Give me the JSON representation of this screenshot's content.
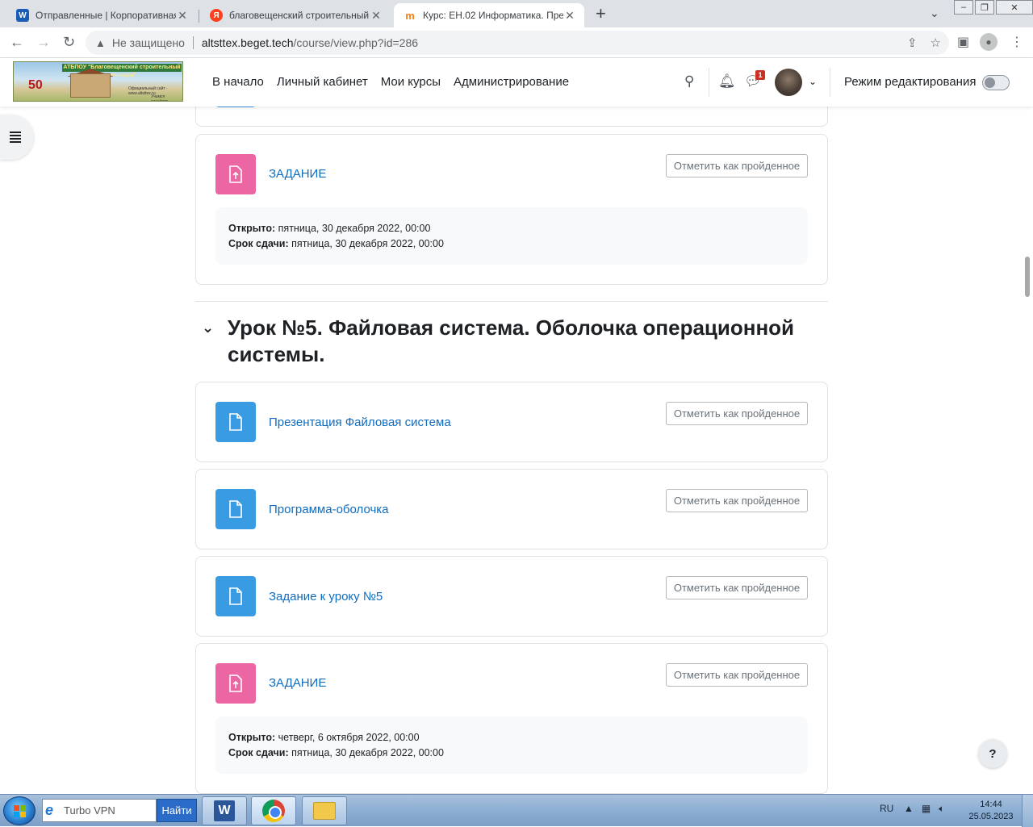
{
  "browser": {
    "tabs": [
      {
        "title": "Отправленные | Корпоративная",
        "favicon_color": "#1a5bb5"
      },
      {
        "title": "благовещенский строительный",
        "favicon_color": "#fc3f1d"
      },
      {
        "title": "Курс: ЕН.02 Информатика. Пре",
        "favicon_color": "#f98012"
      }
    ],
    "new_tab": "+",
    "insecure_label": "Не защищено",
    "url_host": "altsttex.beget.tech",
    "url_path": "/course/view.php?id=286"
  },
  "navbar": {
    "logo": {
      "banner": "АТБПОУ \"Благовещенский строительный техникум\"",
      "fifty": "50",
      "site": "Официальный сайт · www.altsttex.ru",
      "motto": "Учимся созидать"
    },
    "menu": [
      "В начало",
      "Личный кабинет",
      "Мои курсы",
      "Администрирование"
    ],
    "messages_badge": "1",
    "edit_mode_label": "Режим редактирования"
  },
  "content": {
    "mark_label": "Отметить как пройденное",
    "assignment1": {
      "name": "ЗАДАНИЕ",
      "opened_label": "Открыто:",
      "opened_value": "пятница, 30 декабря 2022, 00:00",
      "due_label": "Срок сдачи:",
      "due_value": "пятница, 30 декабря 2022, 00:00"
    },
    "section_title": "Урок №5. Файловая система. Оболочка операционной системы.",
    "activities": [
      {
        "name": "Презентация Файловая система"
      },
      {
        "name": "Программа-оболочка"
      },
      {
        "name": "Задание к уроку №5"
      }
    ],
    "assignment2": {
      "name": "ЗАДАНИЕ",
      "opened_label": "Открыто:",
      "opened_value": "четверг, 6 октября 2022, 00:00",
      "due_label": "Срок сдачи:",
      "due_value": "пятница, 30 декабря 2022, 00:00"
    },
    "help": "?"
  },
  "taskbar": {
    "search_placeholder": "Turbo VPN",
    "find_label": "Найти",
    "word_letter": "W",
    "lang": "RU",
    "time": "14:44",
    "date": "25.05.2023"
  },
  "colors": {
    "link": "#0f6cbf",
    "resource_icon": "#399be2",
    "assignment_icon": "#eb66a2"
  }
}
